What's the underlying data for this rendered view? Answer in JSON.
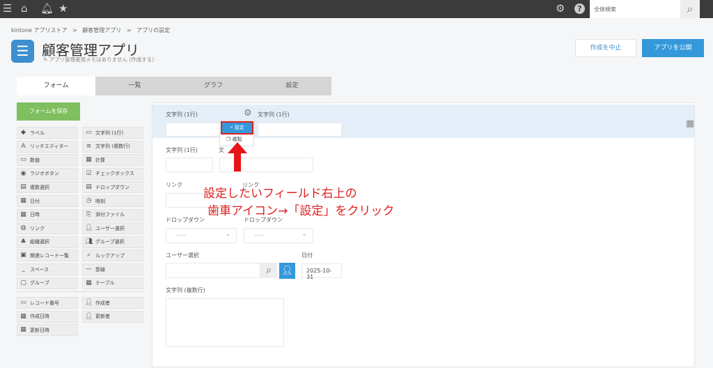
{
  "topbar": {
    "search_placeholder": "全体検索"
  },
  "breadcrumb": [
    "kintone アプリストア",
    "顧客管理アプリ",
    "アプリの設定"
  ],
  "breadcrumb_sep": ">",
  "app": {
    "title": "顧客管理アプリ",
    "memo": "アプリ管理者用メモはありません (作成する)"
  },
  "actions": {
    "cancel": "作成を中止",
    "publish": "アプリを公開"
  },
  "tabs": [
    "フォーム",
    "一覧",
    "グラフ",
    "設定"
  ],
  "palette": {
    "save": "フォームを保存",
    "items": [
      [
        "ラベル",
        "文字列 (1行)"
      ],
      [
        "リッチエディター",
        "文字列 (複数行)"
      ],
      [
        "数値",
        "計算"
      ],
      [
        "ラジオボタン",
        "チェックボックス"
      ],
      [
        "複数選択",
        "ドロップダウン"
      ],
      [
        "日付",
        "時刻"
      ],
      [
        "日時",
        "添付ファイル"
      ],
      [
        "リンク",
        "ユーザー選択"
      ],
      [
        "組織選択",
        "グループ選択"
      ],
      [
        "関連レコード一覧",
        "ルックアップ"
      ],
      [
        "スペース",
        "罫線"
      ],
      [
        "グループ",
        "テーブル"
      ]
    ],
    "system": [
      [
        "レコード番号",
        "作成者"
      ],
      [
        "作成日時",
        "更新者"
      ],
      [
        "更新日時",
        ""
      ]
    ]
  },
  "form": {
    "row1": [
      "文字列 (1行)",
      "文字列 (1行)"
    ],
    "row2": [
      "文字列 (1行)",
      "文"
    ],
    "row3": [
      "リンク",
      "リンク"
    ],
    "row4": [
      "ドロップダウン",
      "ドロップダウン"
    ],
    "select_placeholder": "-----",
    "user_label": "ユーザー選択",
    "date_label": "日付",
    "date_value": "2025-10-31",
    "multiline_label": "文字列 (複数行)"
  },
  "gear_menu": {
    "settings": "設定",
    "copy": "複製"
  },
  "annotation": {
    "line1": "設定したいフィールド右上の",
    "line2": "歯車アイコン→「設定」をクリック"
  },
  "colors": {
    "accent": "#3498db",
    "save": "#7fbf5f",
    "annotation": "#e02020"
  }
}
